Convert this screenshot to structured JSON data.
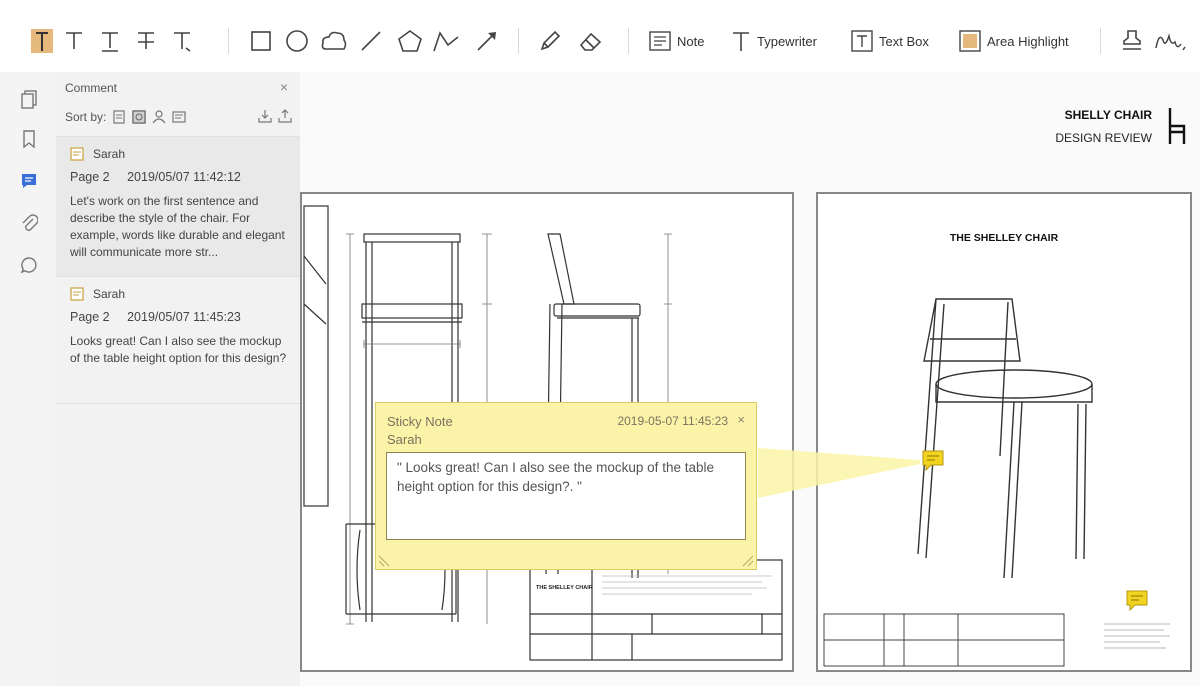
{
  "toolbar": {
    "note_label": "Note",
    "typewriter_label": "Typewriter",
    "textbox_label": "Text Box",
    "area_highlight_label": "Area Highlight"
  },
  "comment_panel": {
    "title": "Comment",
    "close": "×",
    "sort_label": "Sort by:",
    "comments": [
      {
        "author": "Sarah",
        "page": "Page 2",
        "timestamp": "2019/05/07 11:42:12",
        "text": "Let's work on the first sentence and describe the style of the chair. For example, words like durable and elegant will communicate more str..."
      },
      {
        "author": "Sarah",
        "page": "Page 2",
        "timestamp": "2019/05/07 11:45:23",
        "text": "Looks great! Can I also see the mockup of the table height option for this design?"
      }
    ]
  },
  "document": {
    "header_title": "SHELLY CHAIR",
    "header_subtitle": "DESIGN REVIEW",
    "right_page_title": "THE SHELLEY CHAIR",
    "title_block_label": "THE SHELLEY CHAIR"
  },
  "sticky_note": {
    "title": "Sticky Note",
    "author": "Sarah",
    "timestamp": "2019-05-07 11:45:23",
    "close": "×",
    "text": "\" Looks great! Can I also see the mockup of the table height option for this design?. \""
  },
  "colors": {
    "accent": "#3a6fd8",
    "highlight": "#e5b97c",
    "sticky": "#fbf4a8"
  }
}
